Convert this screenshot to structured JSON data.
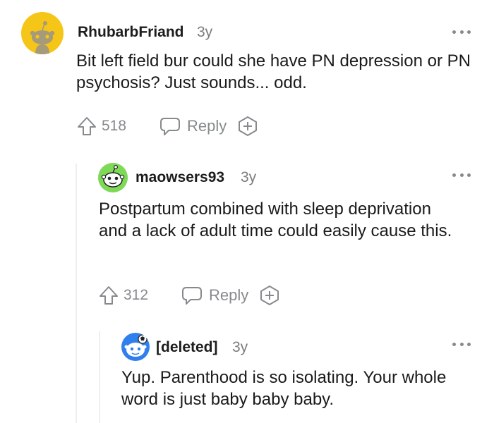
{
  "comments": [
    {
      "username": "RhubarbFriand",
      "age": "3y",
      "body": "Bit left field bur could she have PN depression or PN psychosis? Just sounds... odd.",
      "upvotes": "518",
      "reply_label": "Reply",
      "avatar_color": "#f5c518"
    },
    {
      "username": "maowsers93",
      "age": "3y",
      "body": "Postpartum combined with sleep deprivation and a lack of adult time could easily cause this.",
      "upvotes": "312",
      "reply_label": "Reply",
      "avatar_color": "#7ed957"
    },
    {
      "username": "[deleted]",
      "age": "3y",
      "body": "Yup. Parenthood is so isolating. Your whole word is just baby baby baby.",
      "avatar_color": "#2f80ed"
    }
  ],
  "icons": {
    "upvote": "arrow-up-icon",
    "reply": "speech-bubble-icon",
    "award": "award-plus-icon",
    "more": "more-options-icon"
  }
}
